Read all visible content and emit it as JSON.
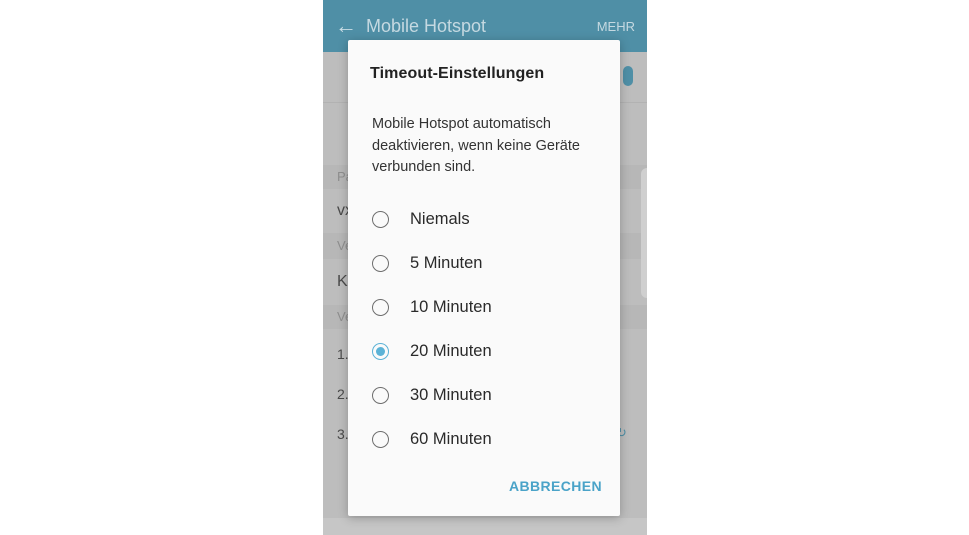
{
  "appbar": {
    "title": "Mobile Hotspot",
    "more_label": "MEHR",
    "back_icon": "back-arrow-icon"
  },
  "background": {
    "rows": [
      "Pa",
      "vx",
      "Ve",
      "K",
      "Ve",
      "1.",
      "2.",
      "3."
    ]
  },
  "dialog": {
    "title": "Timeout-Einstellungen",
    "message": "Mobile Hotspot automatisch deaktivieren, wenn keine Geräte verbunden sind.",
    "options": [
      {
        "label": "Niemals",
        "selected": false
      },
      {
        "label": "5 Minuten",
        "selected": false
      },
      {
        "label": "10 Minuten",
        "selected": false
      },
      {
        "label": "20 Minuten",
        "selected": true
      },
      {
        "label": "30 Minuten",
        "selected": false
      },
      {
        "label": "60 Minuten",
        "selected": false
      }
    ],
    "cancel_label": "ABBRECHEN"
  },
  "colors": {
    "accent": "#5bb2d6",
    "appbar": "#4f8fa6"
  }
}
